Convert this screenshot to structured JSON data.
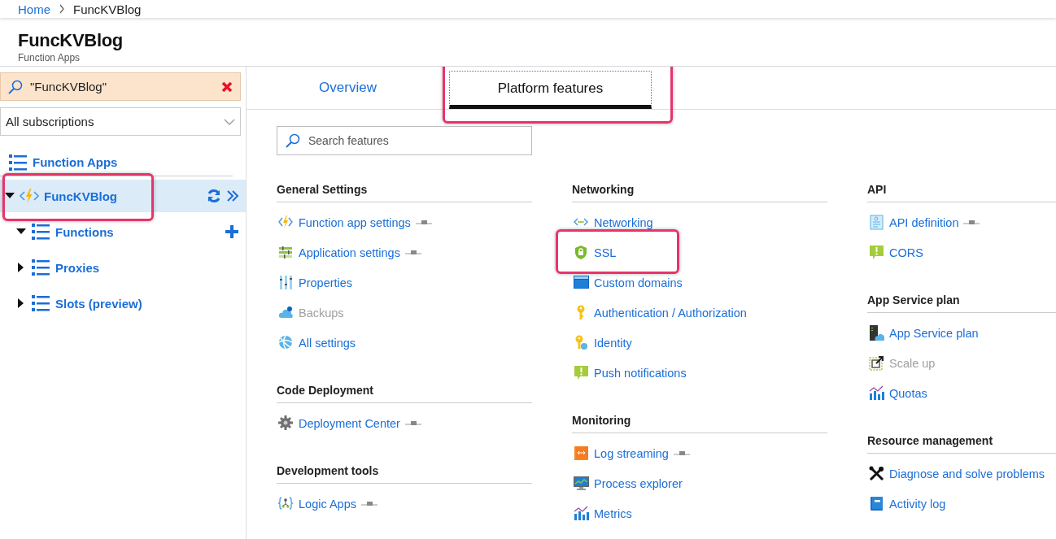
{
  "breadcrumb": [
    {
      "label": "Home",
      "kind": "link"
    },
    {
      "label": "FuncKVBlog",
      "kind": "current"
    }
  ],
  "header": {
    "title": "FuncKVBlog",
    "subtitle": "Function Apps"
  },
  "sidebar": {
    "search": {
      "value": "\"FuncKVBlog\""
    },
    "subscription": {
      "value": "All subscriptions"
    },
    "tree": [
      {
        "label": "Function Apps",
        "kind": "group",
        "selected": false,
        "annotated": false,
        "children": [
          {
            "label": "FuncKVBlog",
            "kind": "app",
            "expanded": true,
            "selected": true,
            "annotated": true,
            "actions": [
              {
                "kind": "refresh"
              },
              {
                "kind": "open"
              }
            ],
            "children": [
              {
                "label": "Functions",
                "kind": "list",
                "expanded": true,
                "selected": false,
                "annotated": false,
                "actions": [
                  {
                    "kind": "add"
                  }
                ]
              },
              {
                "label": "Proxies",
                "kind": "list",
                "expanded": false,
                "selected": false,
                "annotated": false
              },
              {
                "label": "Slots (preview)",
                "kind": "list",
                "expanded": false,
                "selected": false,
                "annotated": false
              }
            ]
          }
        ]
      }
    ]
  },
  "tabs": [
    {
      "label": "Overview",
      "selected": false,
      "annotated": false
    },
    {
      "label": "Platform features",
      "selected": true,
      "annotated": true
    }
  ],
  "search_features": {
    "placeholder": "Search features"
  },
  "columns": [
    {
      "sections": [
        {
          "title": "General Settings",
          "items": [
            {
              "label": "Function app settings",
              "preview": true,
              "disabled": false,
              "annotated": false
            },
            {
              "label": "Application settings",
              "preview": true,
              "disabled": false,
              "annotated": false
            },
            {
              "label": "Properties",
              "preview": false,
              "disabled": false,
              "annotated": false
            },
            {
              "label": "Backups",
              "preview": false,
              "disabled": true,
              "annotated": false
            },
            {
              "label": "All settings",
              "preview": false,
              "disabled": false,
              "annotated": false
            }
          ]
        },
        {
          "title": "Code Deployment",
          "items": [
            {
              "label": "Deployment Center",
              "preview": true,
              "disabled": false,
              "annotated": false
            }
          ]
        },
        {
          "title": "Development tools",
          "items": [
            {
              "label": "Logic Apps",
              "preview": true,
              "disabled": false,
              "annotated": false
            }
          ]
        }
      ]
    },
    {
      "sections": [
        {
          "title": "Networking",
          "items": [
            {
              "label": "Networking",
              "preview": false,
              "disabled": false,
              "annotated": false
            },
            {
              "label": "SSL",
              "preview": false,
              "disabled": false,
              "annotated": true
            },
            {
              "label": "Custom domains",
              "preview": false,
              "disabled": false,
              "annotated": false
            },
            {
              "label": "Authentication / Authorization",
              "preview": false,
              "disabled": false,
              "annotated": false
            },
            {
              "label": "Identity",
              "preview": false,
              "disabled": false,
              "annotated": false
            },
            {
              "label": "Push notifications",
              "preview": false,
              "disabled": false,
              "annotated": false
            }
          ]
        },
        {
          "title": "Monitoring",
          "items": [
            {
              "label": "Log streaming",
              "preview": true,
              "disabled": false,
              "annotated": false
            },
            {
              "label": "Process explorer",
              "preview": false,
              "disabled": false,
              "annotated": false
            },
            {
              "label": "Metrics",
              "preview": false,
              "disabled": false,
              "annotated": false
            }
          ]
        }
      ]
    },
    {
      "sections": [
        {
          "title": "API",
          "items": [
            {
              "label": "API definition",
              "preview": true,
              "disabled": false,
              "annotated": false
            },
            {
              "label": "CORS",
              "preview": false,
              "disabled": false,
              "annotated": false
            }
          ]
        },
        {
          "title": "App Service plan",
          "items": [
            {
              "label": "App Service plan",
              "preview": false,
              "disabled": false,
              "annotated": false
            },
            {
              "label": "Scale up",
              "preview": false,
              "disabled": true,
              "annotated": false
            },
            {
              "label": "Quotas",
              "preview": false,
              "disabled": false,
              "annotated": false
            }
          ]
        },
        {
          "title": "Resource management",
          "items": [
            {
              "label": "Diagnose and solve problems",
              "preview": false,
              "disabled": false,
              "annotated": false
            },
            {
              "label": "Activity log",
              "preview": false,
              "disabled": false,
              "annotated": false
            }
          ]
        }
      ]
    }
  ]
}
